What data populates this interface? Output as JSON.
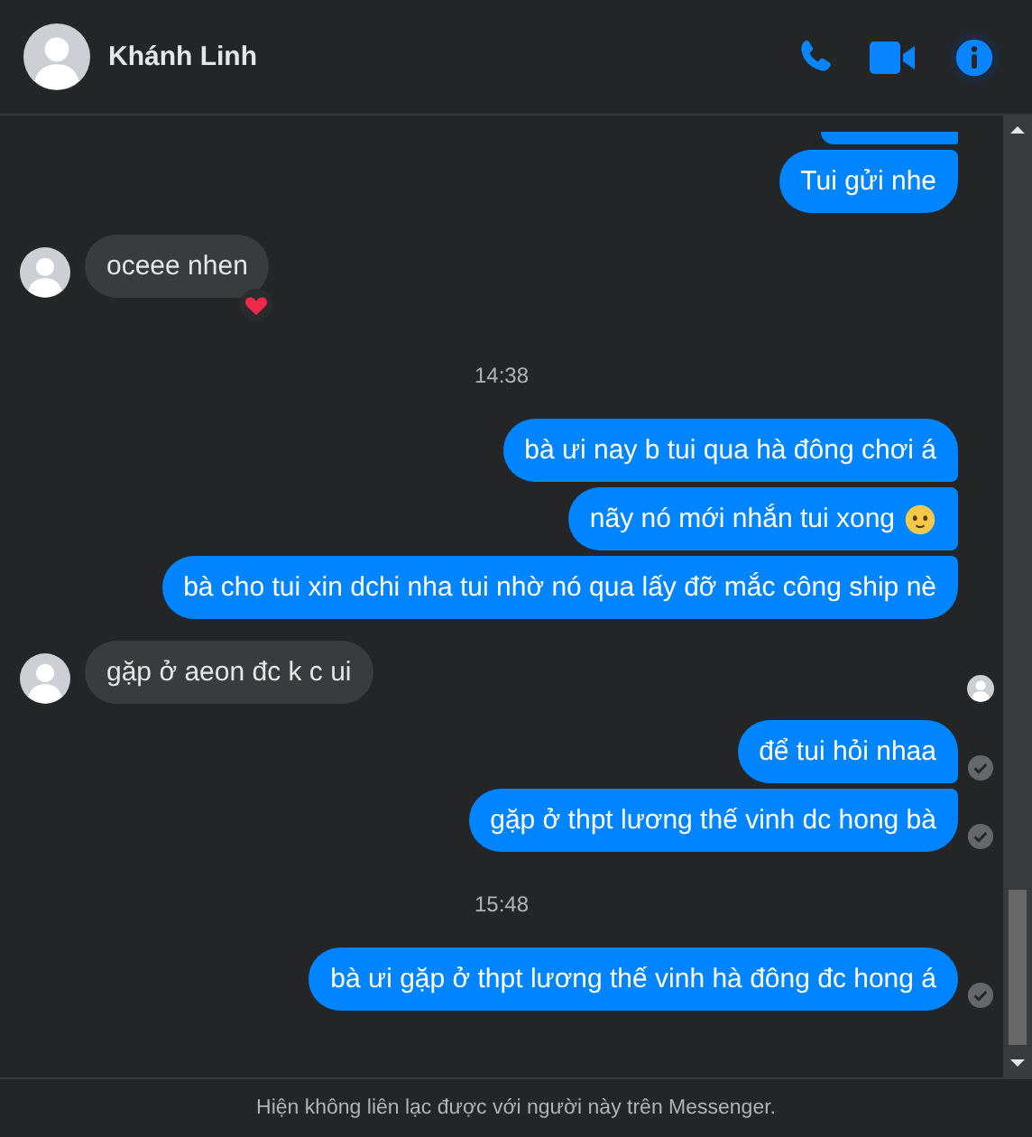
{
  "header": {
    "name": "Khánh Linh"
  },
  "messages": [
    {
      "kind": "out",
      "cut": true,
      "delivered": false,
      "seen": false
    },
    {
      "kind": "out",
      "text": "Tui gửi nhe",
      "delivered": false,
      "seen": false
    },
    {
      "kind": "in",
      "text": "oceee nhen",
      "reaction": true,
      "delivered": false,
      "seen": false
    },
    {
      "kind": "time",
      "text": "14:38"
    },
    {
      "kind": "out",
      "text": "bà ưi nay b tui qua hà đông chơi á",
      "delivered": false,
      "seen": false
    },
    {
      "kind": "out",
      "text": "nãy nó mới nhắn tui xong",
      "emoji": true,
      "delivered": false,
      "seen": false
    },
    {
      "kind": "out",
      "text": "bà cho tui xin dchi nha tui nhờ nó qua lấy đỡ mắc công ship nè",
      "delivered": false,
      "seen": false
    },
    {
      "kind": "in",
      "text": "gặp ở aeon đc k c ui",
      "delivered": false,
      "seen": true
    },
    {
      "kind": "out",
      "text": "để tui hỏi nhaa",
      "delivered": true,
      "seen": false
    },
    {
      "kind": "out",
      "text": "gặp ở thpt lương thế vinh dc hong bà",
      "delivered": true,
      "seen": false
    },
    {
      "kind": "time",
      "text": "15:48"
    },
    {
      "kind": "out",
      "text": "bà ưi gặp ở thpt lương thế vinh hà đông đc hong á",
      "delivered": true,
      "seen": false
    }
  ],
  "footer": {
    "notice": "Hiện không liên lạc được với người này trên Messenger."
  }
}
